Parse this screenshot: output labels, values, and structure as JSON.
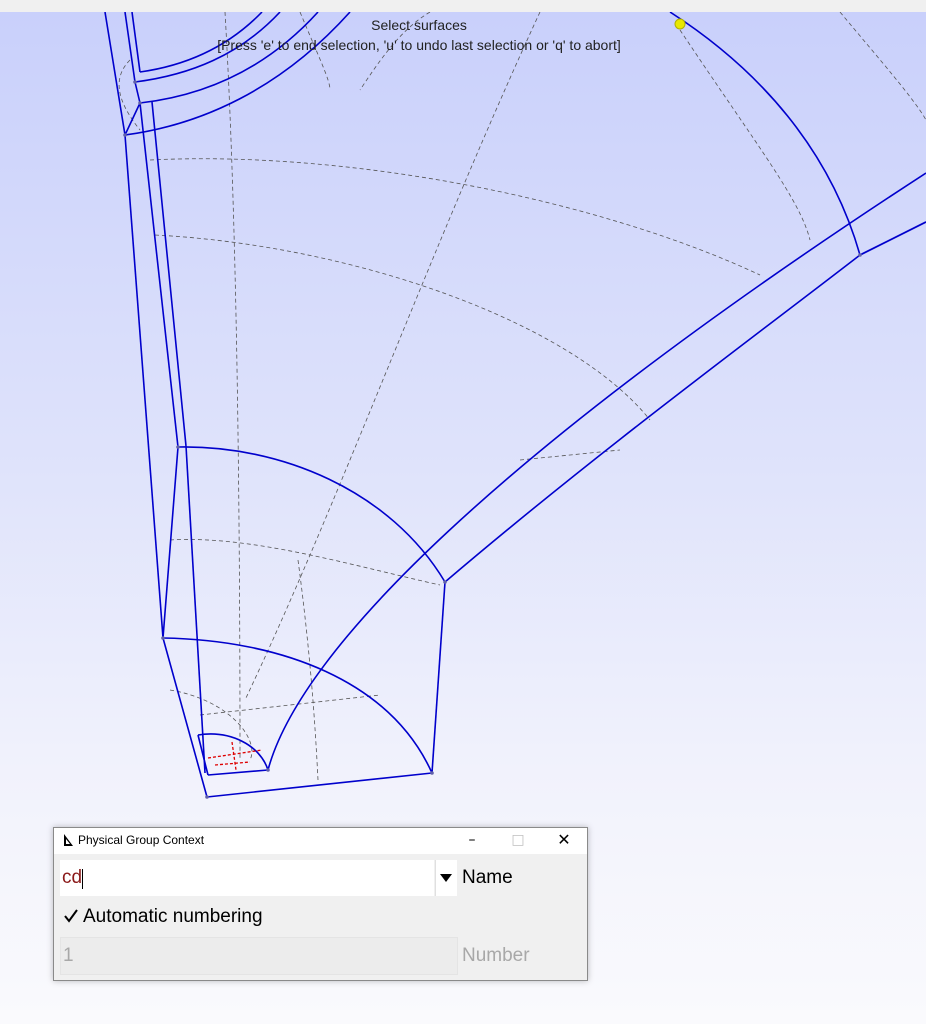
{
  "viewport": {
    "message_title": "Select surfaces",
    "message_hint": "[Press 'e' to end selection, 'u' to undo last selection or 'q' to abort]",
    "colors": {
      "background_top": "#c9d0fb",
      "background_bottom": "#fafafd",
      "geometry_lines": "#0000cc",
      "dashed_lines": "#555555",
      "selection_highlight": "#dd0000",
      "point_marker": "#e8e800"
    }
  },
  "dialog": {
    "title": "Physical Group Context",
    "app_icon": "gmsh-icon",
    "window_buttons": {
      "minimize": "–",
      "maximize": "□",
      "close": "✕"
    },
    "name_field": {
      "value": "cd",
      "label": "Name"
    },
    "auto_numbering": {
      "checked": true,
      "label": "Automatic numbering"
    },
    "number_field": {
      "value": "1",
      "label": "Number",
      "disabled": true
    }
  }
}
